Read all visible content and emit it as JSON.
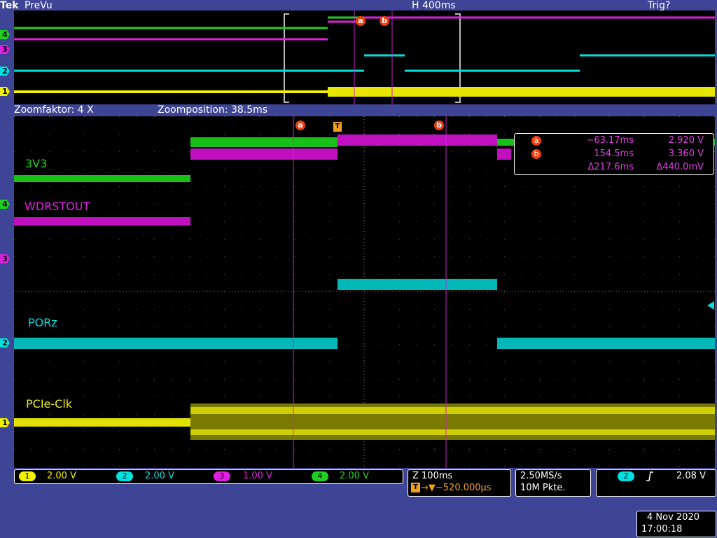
{
  "header": {
    "brand": "Tek",
    "mode": "PreVu",
    "horizontal_scale": "H 400ms",
    "trigger_status": "Trig?"
  },
  "zoom": {
    "factor_label": "Zoomfaktor: 4 X",
    "position_label": "Zoomposition: 38.5ms"
  },
  "trace_labels": {
    "ch4": "3V3",
    "ch3": "WDRSTOUT",
    "ch2": "PORz",
    "ch1": "PCIe-Clk"
  },
  "channel_markers": [
    "4",
    "3",
    "2",
    "1"
  ],
  "cursors": {
    "a_label": "a",
    "b_label": "b",
    "trigger_label": "T"
  },
  "readout": {
    "a_time": "−63.17ms",
    "a_volt": "2.920 V",
    "b_time": "154.5ms",
    "b_volt": "3.360 V",
    "delta_time": "Δ217.6ms",
    "delta_volt": "Δ440.0mV"
  },
  "channels": [
    {
      "num": "1",
      "scale": "2.00 V",
      "color": "#f0f000"
    },
    {
      "num": "2",
      "scale": "2.00 V",
      "color": "#00e0e0"
    },
    {
      "num": "3",
      "scale": "1.00 V",
      "color": "#e020e0"
    },
    {
      "num": "4",
      "scale": "2.00 V",
      "color": "#20d020"
    }
  ],
  "timebase": {
    "zoom_scale": "Z 100ms",
    "trigger_pos": "→▼−520.000µs"
  },
  "acquisition": {
    "rate": "2.50MS/s",
    "length": "10M Pkte."
  },
  "trigger": {
    "channel": "2",
    "slope_icon": "rising-edge-icon",
    "level": "2.08 V"
  },
  "datetime": {
    "date": "4 Nov 2020",
    "time": "17:00:18"
  },
  "colors": {
    "ch1": "#f0f000",
    "ch2": "#00e0e0",
    "ch3": "#e020e0",
    "ch4": "#20d020",
    "cursor": "#f04010",
    "background": "#3f4596"
  }
}
